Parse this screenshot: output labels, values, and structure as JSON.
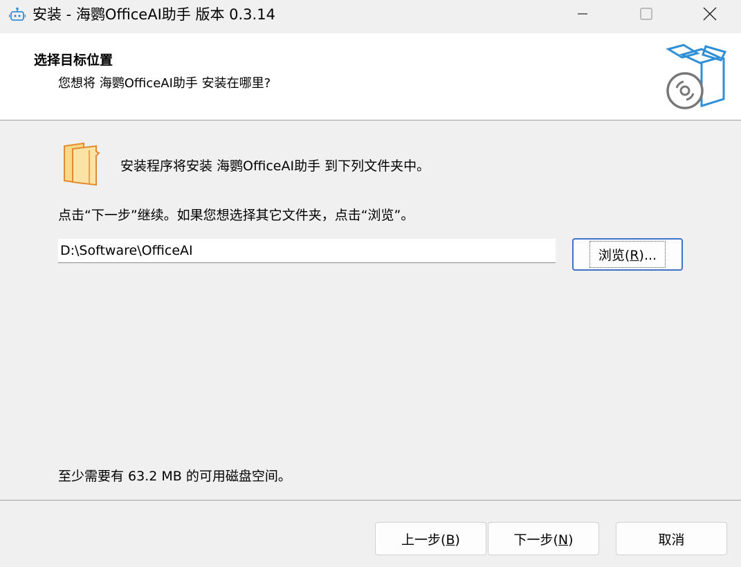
{
  "window": {
    "title": "安装 - 海鹦OfficeAI助手 版本 0.3.14",
    "app_icon": "robot-icon",
    "controls": {
      "minimize": "minimize-icon",
      "maximize": "maximize-icon",
      "close": "close-icon"
    }
  },
  "header": {
    "title": "选择目标位置",
    "subtitle": "您想将 海鹦OfficeAI助手 安装在哪里?",
    "icon": "install-box-icon"
  },
  "main": {
    "folder_icon": "folder-icon",
    "info": "安装程序将安装 海鹦OfficeAI助手 到下列文件夹中。",
    "hint": "点击“下一步”继续。如果您想选择其它文件夹，点击“浏览”。",
    "path_value": "D:\\Software\\OfficeAI",
    "browse": {
      "pre": "浏览(",
      "key": "R",
      "post": ")..."
    },
    "space_required": "至少需要有 63.2 MB 的可用磁盘空间。"
  },
  "footer": {
    "back": {
      "pre": "上一步(",
      "key": "B",
      "post": ")"
    },
    "next": {
      "pre": "下一步(",
      "key": "N",
      "post": ")"
    },
    "cancel": "取消"
  },
  "colors": {
    "accent": "#3b73c8",
    "icon_blue": "#2f8fd6",
    "folder_fill": "#f8d98a",
    "folder_stroke": "#e58a2e"
  }
}
